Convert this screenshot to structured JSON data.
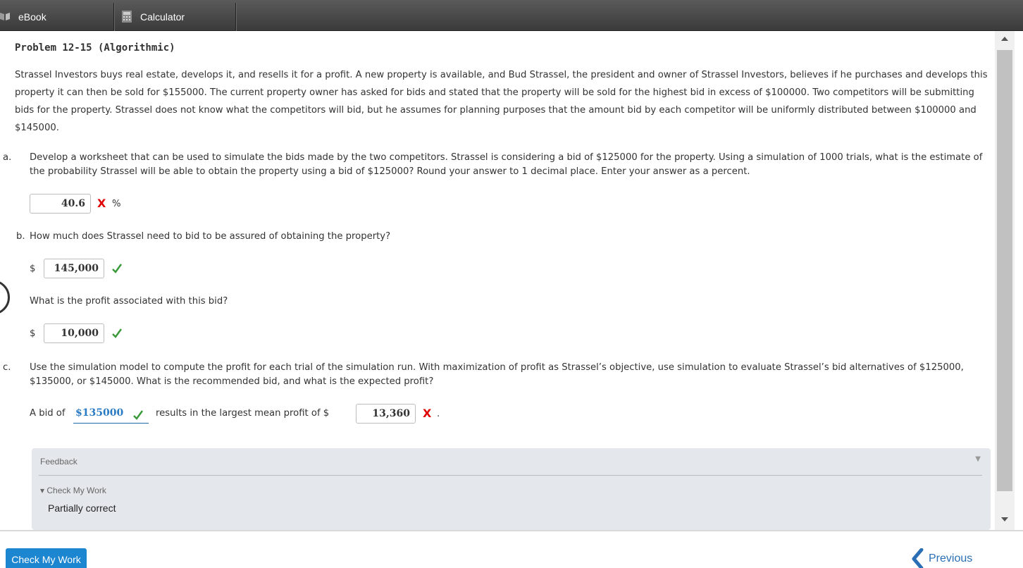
{
  "toolbar": {
    "ebook_label": "eBook",
    "calculator_label": "Calculator"
  },
  "problem": {
    "title": "Problem 12-15 (Algorithmic)",
    "intro": "Strassel Investors buys real estate, develops it, and resells it for a profit. A new property is available, and Bud Strassel, the president and owner of Strassel Investors, believes if he purchases and develops this property it can then be sold for $155000. The current property owner has asked for bids and stated that the property will be sold for the highest bid in excess of $100000. Two competitors will be submitting bids for the property. Strassel does not know what the competitors will bid, but he assumes for planning purposes that the amount bid by each competitor will be uniformly distributed between $100000 and $145000."
  },
  "part_a": {
    "letter": "a.",
    "question": "Develop a worksheet that can be used to simulate the bids made by the two competitors. Strassel is considering a bid of $125000 for the property. Using a simulation of 1000 trials, what is the estimate of the probability Strassel will be able to obtain the property using a bid of $125000? Round your answer to 1 decimal place. Enter your answer as a percent.",
    "answer": "40.6",
    "mark": "X",
    "unit": "%"
  },
  "part_b": {
    "letter": "b.",
    "question": "How much does Strassel need to bid to be assured of obtaining the property?",
    "currency": "$",
    "answer": "145,000",
    "followup": "What is the profit associated with this bid?",
    "profit_currency": "$",
    "profit_answer": "10,000"
  },
  "part_c": {
    "letter": "c.",
    "question": "Use the simulation model to compute the profit for each trial of the simulation run. With maximization of profit as Strassel’s objective, use simulation to evaluate Strassel’s bid alternatives of $125000, $135000, or $145000. What is the recommended bid, and what is the expected profit?",
    "prefix": "A bid of",
    "selected_bid": "$135000",
    "middle": "results in the largest mean profit of $",
    "profit_answer": "13,360",
    "mark": "X",
    "suffix": "."
  },
  "feedback": {
    "title": "Feedback",
    "check_label": "▾ Check My Work",
    "status": "Partially correct"
  },
  "footer": {
    "check_button": "Check My Work",
    "previous_button": "Previous"
  },
  "colors": {
    "correct": "#3a9a3a",
    "incorrect": "#e00000",
    "primary_button": "#1c86d0",
    "link": "#2a6fb5"
  },
  "icons": [
    "book-icon",
    "calculator-icon",
    "check-icon",
    "x-icon",
    "chevron-left-icon"
  ]
}
